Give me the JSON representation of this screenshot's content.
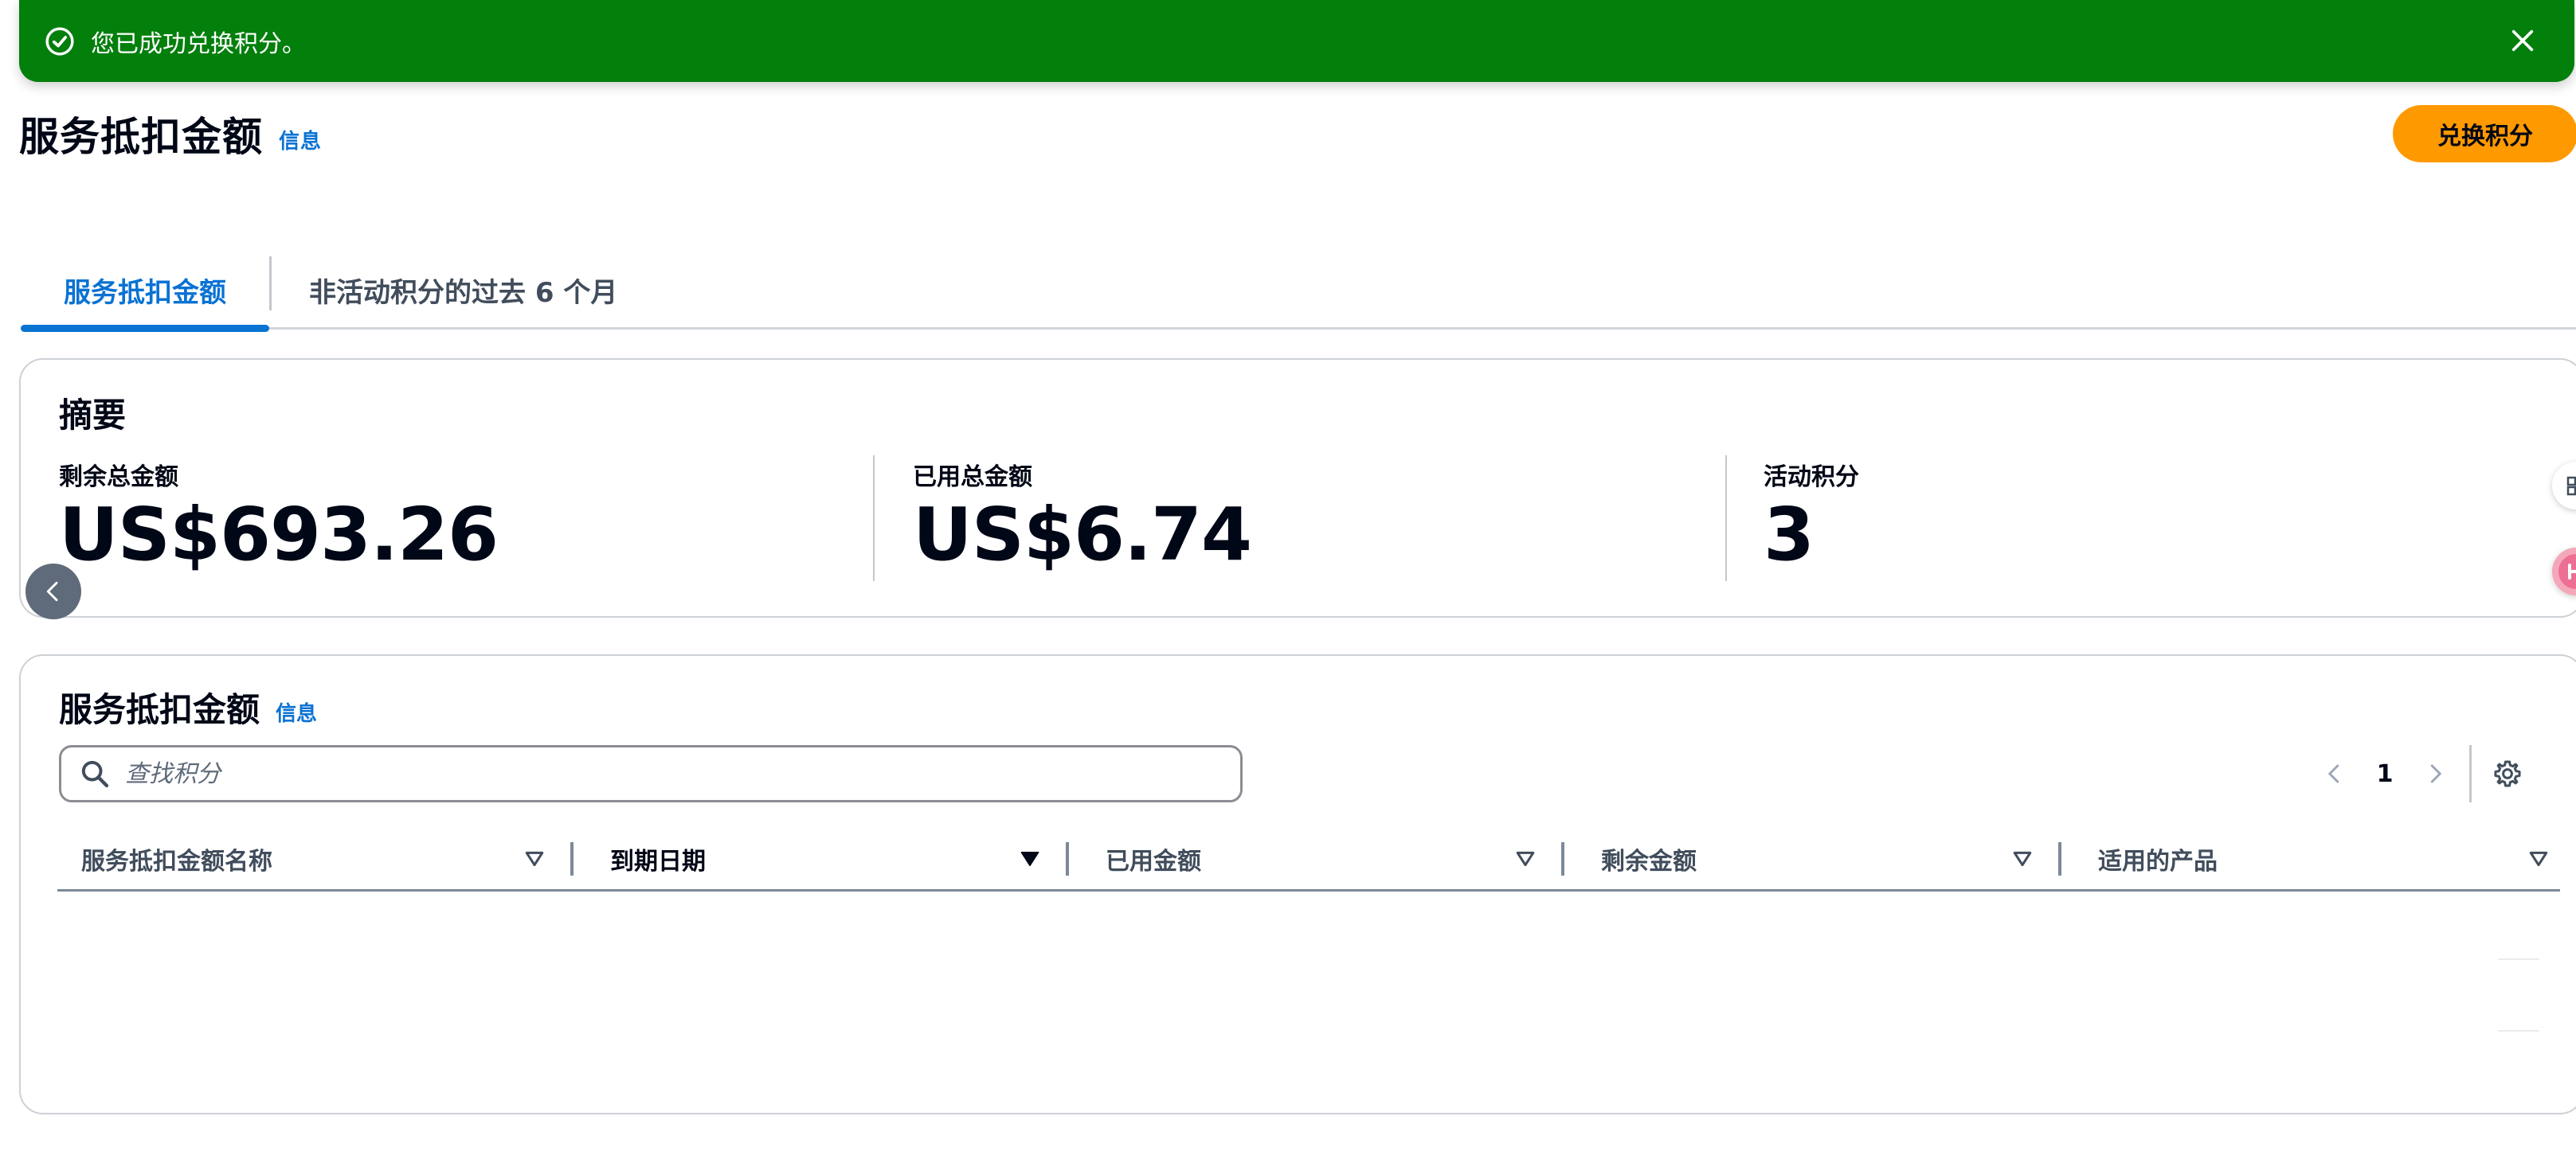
{
  "flash": {
    "message": "您已成功兑换积分。",
    "color": "#037f0c"
  },
  "header": {
    "title": "服务抵扣金额",
    "info_link": "信息",
    "primary_button": "兑换积分",
    "primary_color": "#ff9900"
  },
  "tabs": [
    {
      "label": "服务抵扣金额",
      "active": true
    },
    {
      "label": "非活动积分的过去 6 个月",
      "active": false
    }
  ],
  "summary": {
    "title": "摘要",
    "items": [
      {
        "label": "剩余总金额",
        "value": "US$693.26"
      },
      {
        "label": "已用总金额",
        "value": "US$6.74"
      },
      {
        "label": "活动积分",
        "value": "3"
      }
    ]
  },
  "table": {
    "title": "服务抵扣金额",
    "info_link": "信息",
    "search_placeholder": "查找积分",
    "page": "1",
    "columns": [
      {
        "label": "服务抵扣金额名称",
        "sorted": false
      },
      {
        "label": "到期日期",
        "sorted": true
      },
      {
        "label": "已用金额",
        "sorted": false
      },
      {
        "label": "剩余金额",
        "sorted": false
      },
      {
        "label": "适用的产品",
        "sorted": false
      }
    ],
    "rows": []
  },
  "icons": {
    "flash_status": "check-circle-icon",
    "flash_close": "close-icon",
    "search": "search-icon",
    "pager_prev": "chevron-left-icon",
    "pager_next": "chevron-right-icon",
    "settings": "gear-icon",
    "scroll_left": "chevron-left-icon"
  }
}
